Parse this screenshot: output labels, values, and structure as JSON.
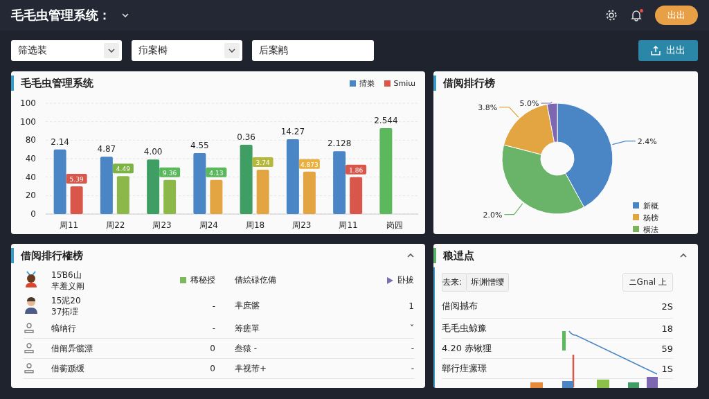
{
  "header": {
    "title": "毛毛虫管理系统：",
    "has_notification": true,
    "button": "出出"
  },
  "filters": [
    {
      "kind": "dropdown",
      "value": "筛选装"
    },
    {
      "kind": "dropdown",
      "value": "疖案榯"
    },
    {
      "kind": "input",
      "value": "后案鹇"
    }
  ],
  "export_button": "出出",
  "bar_card": {
    "title": "毛毛虫管理系统",
    "legend": [
      {
        "label": "揹桊",
        "color": "#4a86c5"
      },
      {
        "label": "Smiɯ",
        "color": "#d9574a"
      }
    ],
    "y_labels": [
      "100",
      "100",
      "80",
      "40",
      "40",
      "20",
      "0"
    ],
    "x_labels": [
      "周11",
      "周22",
      "周23",
      "周24",
      "周18",
      "周23",
      "周11",
      "岗园"
    ],
    "bar_labels": [
      "2.14",
      "4.87",
      "4.00",
      "4.55",
      "0.36",
      "14.27",
      "2.128",
      "2.544"
    ],
    "badges": [
      {
        "label": "5.39",
        "color": "#d9574a"
      },
      {
        "label": "4.49",
        "color": "#7cb342"
      },
      {
        "label": "9.36",
        "color": "#5cb85c"
      },
      {
        "label": "4.13",
        "color": "#5cb85c"
      },
      {
        "label": "3.74",
        "color": "#b5b83a"
      },
      {
        "label": "4.873",
        "color": "#e8b040"
      },
      {
        "label": "1.86",
        "color": "#d9574a"
      }
    ]
  },
  "pie_card": {
    "title": "借阅排行榜",
    "slices": [
      {
        "label": "2.4%",
        "color": "#4a86c5"
      },
      {
        "label": "2.0%",
        "color": "#6ab46a"
      },
      {
        "label": "3.8%",
        "color": "#e2a541"
      },
      {
        "label": "5.0%",
        "color": "#7b68b0"
      }
    ],
    "legend": [
      {
        "label": "新概",
        "color": "#4a86c5"
      },
      {
        "label": "杨榜",
        "color": "#e2a541"
      },
      {
        "label": "横法",
        "color": "#7cb35c"
      }
    ]
  },
  "ranking_card": {
    "title": "借阅排行榷榜",
    "expanded": true,
    "rows": [
      {
        "lines": [
          "15Ɓ6山",
          "芈羞义阐"
        ],
        "tag": {
          "label": "稀秘授",
          "color": "#7cb85c"
        },
        "col3": "借絵碌仡備",
        "action": "卧拔"
      },
      {
        "lines": [
          "15泥20",
          "37拓堽"
        ],
        "col2": "-",
        "col3": "芈庶髂",
        "col4": "1"
      },
      {
        "lines": [
          "犒纳行"
        ],
        "col2": "-",
        "col3": "筹瘥單",
        "col4": "˅"
      },
      {
        "lines": [
          "借阐馵髋漂"
        ],
        "col2": "0",
        "col3": "叁猿 -",
        "col4": "-"
      },
      {
        "lines": [
          "借蘅踬缓"
        ],
        "col2": "0",
        "col3": "芈视芾+",
        "col4": "-"
      }
    ]
  },
  "points_card": {
    "title": "稂迣点",
    "expanded": true,
    "chips": [
      "去来:",
      "坼渊憎缨"
    ],
    "action_button": "ニGnal 上",
    "rows": [
      {
        "label": "借阅撼布",
        "value": "2S"
      },
      {
        "label": "毛毛虫鲸豫",
        "value": "18"
      },
      {
        "label": "4.20 赤锹狸",
        "value": "59"
      },
      {
        "label": "鄣行疰瘰璟",
        "value": "1S"
      }
    ]
  }
}
